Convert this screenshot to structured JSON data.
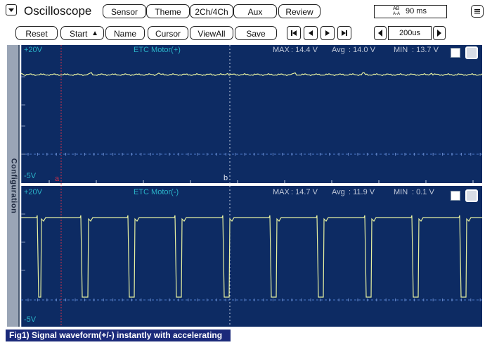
{
  "toolbar": {
    "title": "Oscilloscope",
    "sensor_label": "Sensor",
    "theme_label": "Theme",
    "channels_label": "2Ch/4Ch",
    "aux_label": "Aux",
    "review_label": "Review",
    "sample_icon_text": "AB",
    "sample_icon_sub": "A-A",
    "sample_value": "90 ms"
  },
  "controls": {
    "reset_label": "Reset",
    "start_label": "Start",
    "name_label": "Name",
    "cursor_label": "Cursor",
    "viewall_label": "ViewAll",
    "save_label": "Save",
    "timebase": "200us"
  },
  "sidebar": {
    "label": "Configuration"
  },
  "channel1": {
    "name": "ETC Motor(+)",
    "top_label": "+20V",
    "bottom_label": "-5V",
    "max_label": "MAX",
    "max_value": ": 14.4 V",
    "avg_label": "Avg",
    "avg_value": ": 14.0 V",
    "min_label": "MIN",
    "min_value": ": 13.7 V",
    "cursor_a": "a",
    "cursor_b": "b"
  },
  "channel2": {
    "name": "ETC Motor(-)",
    "top_label": "+20V",
    "bottom_label": "-5V",
    "max_label": "MAX",
    "max_value": ": 14.7 V",
    "avg_label": "Avg",
    "avg_value": ": 11.9 V",
    "min_label": "MIN",
    "min_value": ": 0.1 V"
  },
  "caption": "Fig1) Signal waveform(+/-) instantly with accelerating",
  "colors": {
    "background": "#0d2b63",
    "trace": "#e6f0a0",
    "cursor_a": "#d0304a",
    "label": "#2ab3c8"
  }
}
